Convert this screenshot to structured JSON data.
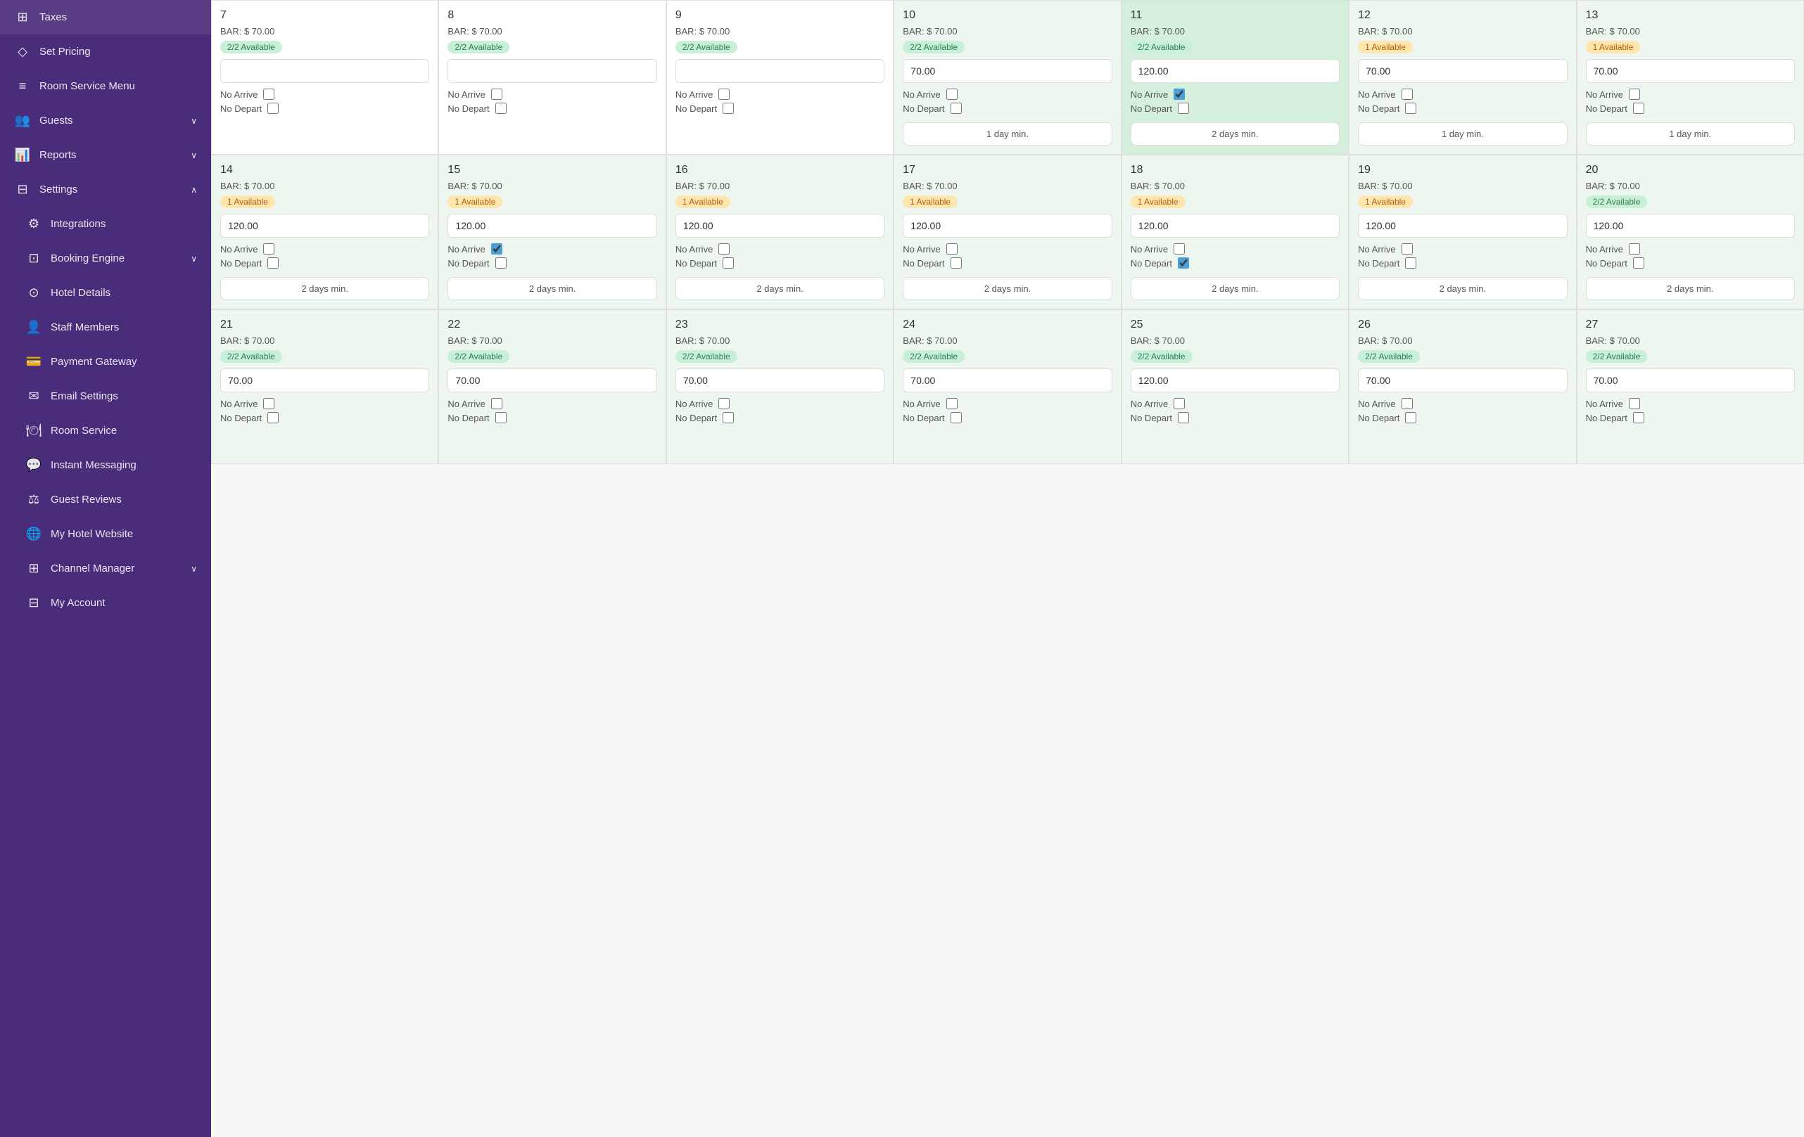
{
  "sidebar": {
    "items": [
      {
        "id": "taxes",
        "label": "Taxes",
        "icon": "⊞",
        "indent": false
      },
      {
        "id": "set-pricing",
        "label": "Set Pricing",
        "icon": "◇",
        "indent": false
      },
      {
        "id": "room-service-menu",
        "label": "Room Service Menu",
        "icon": "≡",
        "indent": false
      },
      {
        "id": "guests",
        "label": "Guests",
        "icon": "👥",
        "indent": false,
        "hasChevron": true
      },
      {
        "id": "reports",
        "label": "Reports",
        "icon": "📊",
        "indent": false,
        "hasChevron": true
      },
      {
        "id": "settings",
        "label": "Settings",
        "icon": "⊟",
        "indent": false,
        "hasChevron": true,
        "expanded": true
      },
      {
        "id": "integrations",
        "label": "Integrations",
        "icon": "⚙",
        "indent": true
      },
      {
        "id": "booking-engine",
        "label": "Booking Engine",
        "icon": "⊡",
        "indent": true,
        "hasChevron": true
      },
      {
        "id": "hotel-details",
        "label": "Hotel Details",
        "icon": "⊙",
        "indent": true
      },
      {
        "id": "staff-members",
        "label": "Staff Members",
        "icon": "👤",
        "indent": true
      },
      {
        "id": "payment-gateway",
        "label": "Payment Gateway",
        "icon": "💳",
        "indent": true
      },
      {
        "id": "email-settings",
        "label": "Email Settings",
        "icon": "✉",
        "indent": true
      },
      {
        "id": "room-service",
        "label": "Room Service",
        "icon": "🍽",
        "indent": true
      },
      {
        "id": "instant-messaging",
        "label": "Instant Messaging",
        "icon": "💬",
        "indent": true
      },
      {
        "id": "guest-reviews",
        "label": "Guest Reviews",
        "icon": "⚖",
        "indent": true
      },
      {
        "id": "my-hotel-website",
        "label": "My Hotel Website",
        "icon": "🌐",
        "indent": true
      },
      {
        "id": "channel-manager",
        "label": "Channel Manager",
        "icon": "⊞",
        "indent": true,
        "hasChevron": true
      },
      {
        "id": "my-account",
        "label": "My Account",
        "icon": "⊟",
        "indent": true
      }
    ]
  },
  "calendar": {
    "rows": [
      {
        "days": [
          {
            "num": 7,
            "bar": "$ 70.00",
            "availability": "2/2 Available",
            "avType": "green",
            "price": "",
            "noArrive": false,
            "noDepart": false,
            "minDays": null,
            "bg": "white"
          },
          {
            "num": 8,
            "bar": "$ 70.00",
            "availability": "2/2 Available",
            "avType": "green",
            "price": "",
            "noArrive": false,
            "noDepart": false,
            "minDays": null,
            "bg": "white"
          },
          {
            "num": 9,
            "bar": "$ 70.00",
            "availability": "2/2 Available",
            "avType": "green",
            "price": "",
            "noArrive": false,
            "noDepart": false,
            "minDays": null,
            "bg": "white"
          },
          {
            "num": 10,
            "bar": "$ 70.00",
            "availability": "2/2 Available",
            "avType": "green",
            "price": "70.00",
            "noArrive": false,
            "noDepart": false,
            "minDays": "1 day min.",
            "bg": "light-green"
          },
          {
            "num": 11,
            "bar": "$ 70.00",
            "availability": "2/2 Available",
            "avType": "green",
            "price": "120.00",
            "noArrive": true,
            "noDepart": false,
            "minDays": "2 days min.",
            "bg": "green"
          },
          {
            "num": 12,
            "bar": "$ 70.00",
            "availability": "1 Available",
            "avType": "orange",
            "price": "70.00",
            "noArrive": false,
            "noDepart": false,
            "minDays": "1 day min.",
            "bg": "light-green"
          },
          {
            "num": 13,
            "bar": "$ 70.00",
            "availability": "1 Available",
            "avType": "orange",
            "price": "70.00",
            "noArrive": false,
            "noDepart": false,
            "minDays": "1 day min.",
            "bg": "light-green"
          }
        ]
      },
      {
        "days": [
          {
            "num": 14,
            "bar": "$ 70.00",
            "availability": "1 Available",
            "avType": "orange",
            "price": "120.00",
            "noArrive": false,
            "noDepart": false,
            "minDays": "2 days min.",
            "bg": "light-green"
          },
          {
            "num": 15,
            "bar": "$ 70.00",
            "availability": "1 Available",
            "avType": "orange",
            "price": "120.00",
            "noArrive": true,
            "noDepart": false,
            "minDays": "2 days min.",
            "bg": "light-green"
          },
          {
            "num": 16,
            "bar": "$ 70.00",
            "availability": "1 Available",
            "avType": "orange",
            "price": "120.00",
            "noArrive": false,
            "noDepart": false,
            "minDays": "2 days min.",
            "bg": "light-green"
          },
          {
            "num": 17,
            "bar": "$ 70.00",
            "availability": "1 Available",
            "avType": "orange",
            "price": "120.00",
            "noArrive": false,
            "noDepart": false,
            "minDays": "2 days min.",
            "bg": "light-green"
          },
          {
            "num": 18,
            "bar": "$ 70.00",
            "availability": "1 Available",
            "avType": "orange",
            "price": "120.00",
            "noArrive": false,
            "noDepart": true,
            "minDays": "2 days min.",
            "bg": "light-green"
          },
          {
            "num": 19,
            "bar": "$ 70.00",
            "availability": "1 Available",
            "avType": "orange",
            "price": "120.00",
            "noArrive": false,
            "noDepart": false,
            "minDays": "2 days min.",
            "bg": "light-green"
          },
          {
            "num": 20,
            "bar": "$ 70.00",
            "availability": "2/2 Available",
            "avType": "green",
            "price": "120.00",
            "noArrive": false,
            "noDepart": false,
            "minDays": "2 days min.",
            "bg": "light-green"
          }
        ]
      },
      {
        "days": [
          {
            "num": 21,
            "bar": "$ 70.00",
            "availability": "2/2 Available",
            "avType": "green",
            "price": "70.00",
            "noArrive": false,
            "noDepart": false,
            "minDays": null,
            "bg": "light-green"
          },
          {
            "num": 22,
            "bar": "$ 70.00",
            "availability": "2/2 Available",
            "avType": "green",
            "price": "70.00",
            "noArrive": false,
            "noDepart": false,
            "minDays": null,
            "bg": "light-green"
          },
          {
            "num": 23,
            "bar": "$ 70.00",
            "availability": "2/2 Available",
            "avType": "green",
            "price": "70.00",
            "noArrive": false,
            "noDepart": false,
            "minDays": null,
            "bg": "light-green"
          },
          {
            "num": 24,
            "bar": "$ 70.00",
            "availability": "2/2 Available",
            "avType": "green",
            "price": "70.00",
            "noArrive": false,
            "noDepart": false,
            "minDays": null,
            "bg": "light-green"
          },
          {
            "num": 25,
            "bar": "$ 70.00",
            "availability": "2/2 Available",
            "avType": "green",
            "price": "120.00",
            "noArrive": false,
            "noDepart": false,
            "minDays": null,
            "bg": "light-green"
          },
          {
            "num": 26,
            "bar": "$ 70.00",
            "availability": "2/2 Available",
            "avType": "green",
            "price": "70.00",
            "noArrive": false,
            "noDepart": false,
            "minDays": null,
            "bg": "light-green"
          },
          {
            "num": 27,
            "bar": "$ 70.00",
            "availability": "2/2 Available",
            "avType": "green",
            "price": "70.00",
            "noArrive": false,
            "noDepart": false,
            "minDays": null,
            "bg": "light-green"
          }
        ]
      }
    ],
    "labels": {
      "noArrive": "No Arrive",
      "noDepart": "No Depart",
      "bar": "BAR:"
    }
  }
}
